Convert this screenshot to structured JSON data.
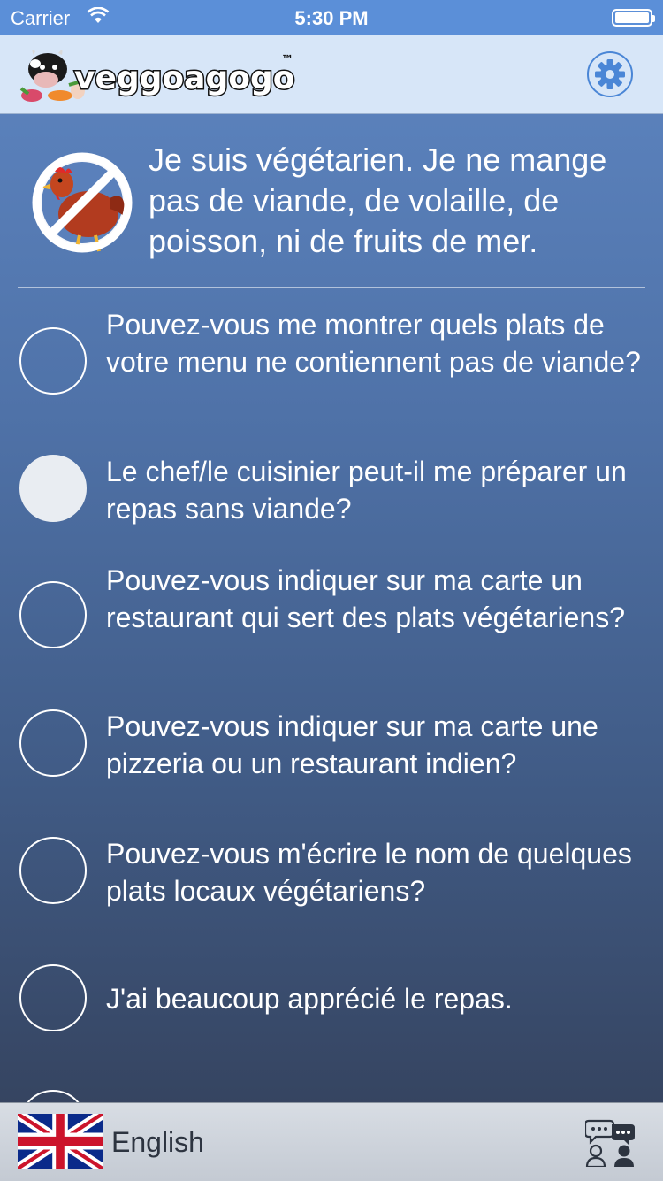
{
  "status_bar": {
    "carrier": "Carrier",
    "time": "5:30 PM"
  },
  "header": {
    "app_name": "veggoagogo",
    "trademark": "™",
    "settings_icon": "gear-icon",
    "accent_color": "#4a86d6"
  },
  "intro": {
    "icon": "no-poultry-icon",
    "text": "Je suis végétarien. Je ne mange pas de viande, de volaille, de poisson, ni de fruits de mer."
  },
  "phrases": [
    {
      "text": "Pouvez-vous me montrer quels plats de votre menu ne contiennent pas de viande?",
      "selected": false
    },
    {
      "text": "Le chef/le cuisinier peut-il me préparer un repas sans viande?",
      "selected": true
    },
    {
      "text": "Pouvez-vous indiquer sur ma carte un restaurant qui sert des plats végétariens?",
      "selected": false
    },
    {
      "text": "Pouvez-vous indiquer sur ma carte une pizzeria ou un restaurant indien?",
      "selected": false
    },
    {
      "text": "Pouvez-vous m'écrire le nom de quelques plats locaux végétariens?",
      "selected": false
    },
    {
      "text": "J'ai beaucoup apprécié le repas.",
      "selected": false
    }
  ],
  "footer": {
    "language": "English",
    "flag_icon": "uk-flag-icon",
    "chat_icon": "conversation-icon"
  }
}
